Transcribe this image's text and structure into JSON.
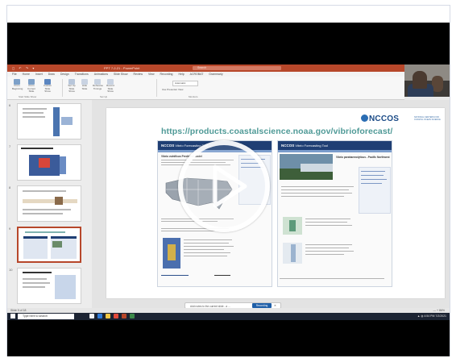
{
  "window": {
    "title": "PPT 7-2-21 - PowerPoint",
    "search_placeholder": "Search",
    "qat": "◻ ↶ ↷ ▾"
  },
  "ribbon_tabs": [
    "File",
    "Home",
    "Insert",
    "Draw",
    "Design",
    "Transitions",
    "Animations",
    "Slide Show",
    "Review",
    "View",
    "Recording",
    "Help",
    "ACROBAT",
    "Grammarly"
  ],
  "ribbon": {
    "buttons": [
      "From Beginning",
      "From Current Slide",
      "Custom Slide Show",
      "Set Up Slide Show",
      "Hide Slide",
      "Rehearse Timings",
      "Record Slide Show"
    ],
    "groups": [
      "Start Slide Show",
      "Set Up",
      "Monitors"
    ],
    "monitor_value": "Automatic",
    "presenter_view": "Use Presenter View"
  },
  "thumbnails": {
    "numbers": [
      "6",
      "7",
      "8",
      "9",
      "10"
    ],
    "selected_index": 3
  },
  "slide": {
    "org_name": "NCCOS",
    "org_sub": "NATIONAL CENTERS FOR COASTAL OCEAN SCIENCE",
    "url": "https://products.coastalscience.noaa.gov/vibrioforecast/",
    "left_page": {
      "bar": "NCCOS",
      "bar_sub": "Vibrio Forecasting Tool",
      "heading": "Vibrio vulnificus Predictive Model"
    },
    "right_page": {
      "bar": "NCCOS",
      "bar_sub": "Vibrio Forecasting Tool",
      "heading": "Vibrio parahaemolyticus - Pacific Northwest"
    }
  },
  "notes_bar": {
    "text": "Add notes to the current slide - a ...",
    "button": "Recording",
    "dismiss": "✕"
  },
  "statusbar": {
    "slide_info": "Slide 9 of 18",
    "zoom": "— + 86%"
  },
  "taskbar": {
    "search": "Type here to search",
    "tray": "▲ ◍ 4:54 PM  7/2/2021"
  },
  "colors": {
    "ppt_accent": "#b7472a",
    "url_teal": "#4f9a97",
    "noaa_blue": "#1f3f74"
  },
  "video": {
    "overlay": "play-button"
  }
}
